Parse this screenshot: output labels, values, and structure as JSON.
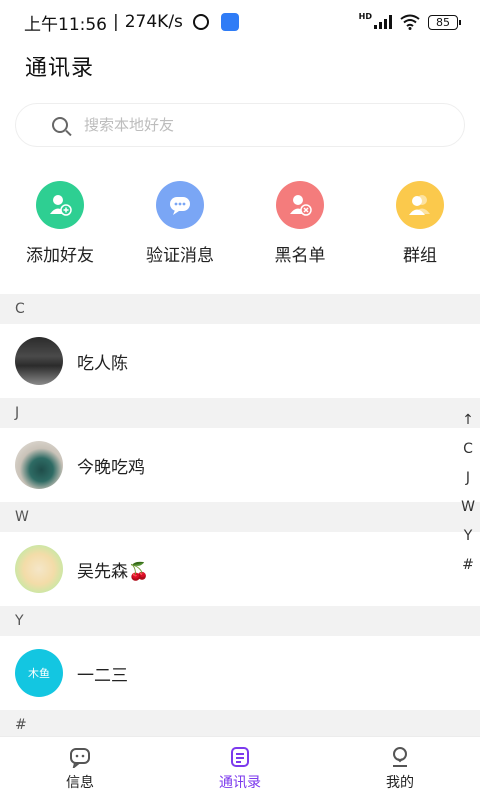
{
  "status_bar": {
    "time": "上午11:56",
    "speed": "274K/s",
    "hd": "HD",
    "battery": "85"
  },
  "header": {
    "title": "通讯录"
  },
  "search": {
    "placeholder": "搜索本地好友"
  },
  "actions": [
    {
      "label": "添加好友",
      "icon": "add-user-icon",
      "color": "#2ecf92"
    },
    {
      "label": "验证消息",
      "icon": "chat-bubble-icon",
      "color": "#7aa6f5"
    },
    {
      "label": "黑名单",
      "icon": "block-user-icon",
      "color": "#f47c7c"
    },
    {
      "label": "群组",
      "icon": "group-icon",
      "color": "#fbc94c"
    }
  ],
  "contacts": [
    {
      "letter": "C",
      "name": "吃人陈",
      "avatar": "keyboard-photo"
    },
    {
      "letter": "J",
      "name": "今晚吃鸡",
      "avatar": "mug-photo"
    },
    {
      "letter": "W",
      "name": "吴先森🍒",
      "avatar": "cartoon-photo"
    },
    {
      "letter": "Y",
      "name": "一二三",
      "avatar_text": "木鱼",
      "avatar": "text-avatar"
    },
    {
      "letter": "#"
    }
  ],
  "index_bar": [
    "↑",
    "C",
    "J",
    "W",
    "Y",
    "#"
  ],
  "nav": {
    "tabs": [
      {
        "label": "信息",
        "icon": "message-icon"
      },
      {
        "label": "通讯录",
        "icon": "contacts-icon",
        "active": true
      },
      {
        "label": "我的",
        "icon": "profile-icon"
      }
    ],
    "active_color": "#7c3aed"
  }
}
